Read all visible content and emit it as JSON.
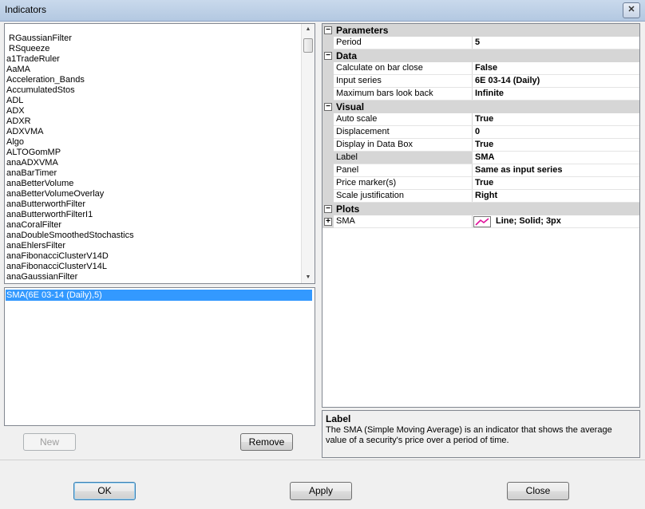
{
  "window": {
    "title": "Indicators",
    "close_glyph": "✕"
  },
  "indicator_list": {
    "items": [
      {
        "label": "RGaussianFilter",
        "indent": true
      },
      {
        "label": "RSqueeze",
        "indent": true
      },
      {
        "label": "a1TradeRuler"
      },
      {
        "label": "AaMA"
      },
      {
        "label": "Acceleration_Bands"
      },
      {
        "label": "AccumulatedStos"
      },
      {
        "label": "ADL"
      },
      {
        "label": "ADX"
      },
      {
        "label": "ADXR"
      },
      {
        "label": "ADXVMA"
      },
      {
        "label": "Algo"
      },
      {
        "label": "ALTOGomMP"
      },
      {
        "label": "anaADXVMA"
      },
      {
        "label": "anaBarTimer"
      },
      {
        "label": "anaBetterVolume"
      },
      {
        "label": "anaBetterVolumeOverlay"
      },
      {
        "label": "anaButterworthFilter"
      },
      {
        "label": "anaButterworthFilterI1"
      },
      {
        "label": "anaCoralFilter"
      },
      {
        "label": "anaDoubleSmoothedStochastics"
      },
      {
        "label": "anaEhlersFilter"
      },
      {
        "label": "anaFibonacciClusterV14D"
      },
      {
        "label": "anaFibonacciClusterV14L"
      },
      {
        "label": "anaGaussianFilter"
      }
    ]
  },
  "applied": {
    "selected": "SMA(6E 03-14 (Daily),5)"
  },
  "buttons": {
    "new": "New",
    "remove": "Remove",
    "ok": "OK",
    "apply": "Apply",
    "close": "Close"
  },
  "properties": {
    "categories": [
      {
        "name": "Parameters",
        "props": [
          {
            "name": "Period",
            "value": "5"
          }
        ]
      },
      {
        "name": "Data",
        "props": [
          {
            "name": "Calculate on bar close",
            "value": "False"
          },
          {
            "name": "Input series",
            "value": "6E 03-14 (Daily)"
          },
          {
            "name": "Maximum bars look back",
            "value": "Infinite"
          }
        ]
      },
      {
        "name": "Visual",
        "props": [
          {
            "name": "Auto scale",
            "value": "True"
          },
          {
            "name": "Displacement",
            "value": "0"
          },
          {
            "name": "Display in Data Box",
            "value": "True"
          },
          {
            "name": "Label",
            "value": "SMA"
          },
          {
            "name": "Panel",
            "value": "Same as input series"
          },
          {
            "name": "Price marker(s)",
            "value": "True"
          },
          {
            "name": "Scale justification",
            "value": "Right"
          }
        ]
      },
      {
        "name": "Plots",
        "props": [
          {
            "name": "SMA",
            "value": "Line; Solid; 3px"
          }
        ]
      }
    ],
    "toggle_minus": "−",
    "toggle_plus": "+"
  },
  "description": {
    "title": "Label",
    "text": "The SMA (Simple Moving Average) is an indicator that shows the average value of a security's price over a period of time."
  },
  "colors": {
    "plot_line": "#e0109a",
    "selection": "#3399ff"
  },
  "icons": {
    "scroll_up": "▲",
    "scroll_down": "▼"
  }
}
